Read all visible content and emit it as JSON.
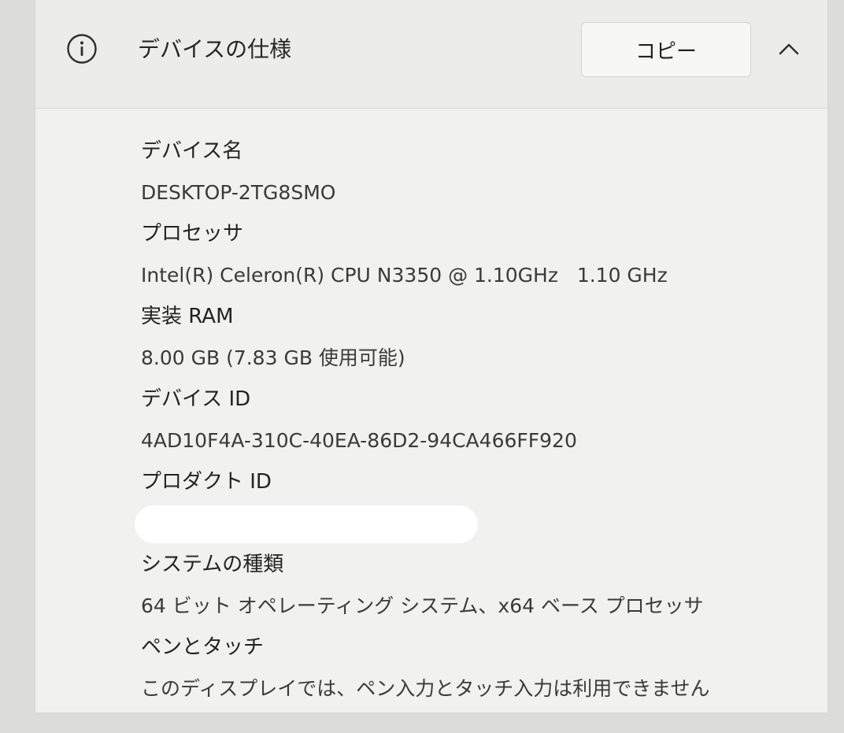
{
  "header": {
    "title": "デバイスの仕様",
    "copy_label": "コピー",
    "info_icon": "info-icon",
    "collapse_icon": "chevron-up-icon"
  },
  "specs": {
    "device_name": {
      "label": "デバイス名",
      "value": "DESKTOP-2TG8SMO"
    },
    "processor": {
      "label": "プロセッサ",
      "value": "Intel(R) Celeron(R) CPU N3350 @ 1.10GHz   1.10 GHz"
    },
    "ram": {
      "label": "実装 RAM",
      "value": "8.00 GB (7.83 GB 使用可能)"
    },
    "device_id": {
      "label": "デバイス ID",
      "value": "4AD10F4A-310C-40EA-86D2-94CA466FF920"
    },
    "product_id": {
      "label": "プロダクト ID",
      "value": ""
    },
    "system_type": {
      "label": "システムの種類",
      "value": "64 ビット オペレーティング システム、x64 ベース プロセッサ"
    },
    "pen_touch": {
      "label": "ペンとタッチ",
      "value": "このディスプレイでは、ペン入力とタッチ入力は利用できません"
    }
  }
}
